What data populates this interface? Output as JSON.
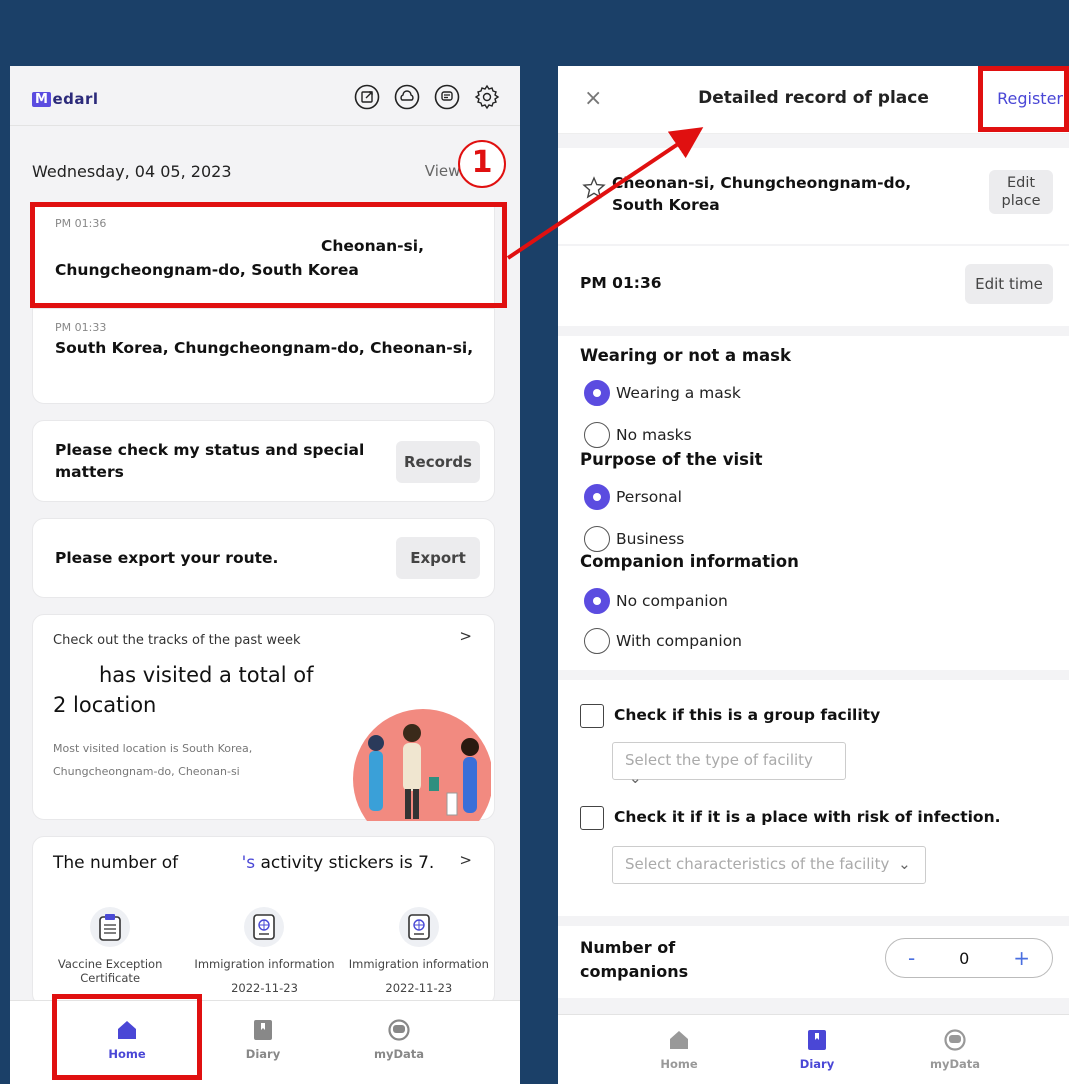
{
  "left": {
    "logo": "Medarl",
    "date": "Wednesday, 04 05, 2023",
    "view_all": "View all >",
    "entries": [
      {
        "time": "PM 01:36",
        "line1": "Cheonan-si,",
        "line2": "Chungcheongnam-do, South Korea"
      },
      {
        "time": "PM 01:33",
        "line1": "South Korea, Chungcheongnam-do, Cheonan-si,"
      }
    ],
    "status_card": {
      "text": "Please check my status and special matters",
      "button": "Records"
    },
    "export_card": {
      "text": "Please export your route.",
      "button": "Export"
    },
    "tracks_card": {
      "header": "Check out the tracks of the past week",
      "chevron": ">",
      "line1": "has visited a total of",
      "line2": "2 location",
      "desc": "Most visited location is South Korea, Chungcheongnam-do, Cheonan-si"
    },
    "stickers_card": {
      "title_prefix": "The number of",
      "title_possessive": "'s",
      "title_suffix": "activity stickers is 7.",
      "chevron": ">",
      "items": [
        {
          "label": "Vaccine Exception Certificate",
          "date": "",
          "icon": "clipboard-icon"
        },
        {
          "label": "Immigration information",
          "date": "2022-11-23",
          "icon": "passport-icon"
        },
        {
          "label": "Immigration information",
          "date": "2022-11-23",
          "icon": "passport-icon"
        }
      ]
    },
    "nav": [
      {
        "label": "Home",
        "icon": "home-icon",
        "active": true
      },
      {
        "label": "Diary",
        "icon": "diary-icon",
        "active": false
      },
      {
        "label": "myData",
        "icon": "mydata-icon",
        "active": false
      }
    ]
  },
  "right": {
    "close": "×",
    "title": "Detailed record of place",
    "register": "Register",
    "place": "Cheonan-si, Chungcheongnam-do, South Korea",
    "edit_place": "Edit place",
    "time": "PM 01:36",
    "edit_time": "Edit time",
    "mask": {
      "heading": "Wearing or not a mask",
      "options": [
        "Wearing a mask",
        "No masks"
      ],
      "selected": 0
    },
    "purpose": {
      "heading": "Purpose of the visit",
      "options": [
        "Personal",
        "Business"
      ],
      "selected": 0
    },
    "companion": {
      "heading": "Companion information",
      "options": [
        "No companion",
        "With companion"
      ],
      "selected": 0
    },
    "group_facility": {
      "label": "Check if this is a group facility",
      "select_placeholder": "Select the type of facility"
    },
    "risk": {
      "label": "Check it if it is a place with risk of infection.",
      "select_placeholder": "Select characteristics of the facility"
    },
    "companions_count": {
      "label": "Number of companions",
      "minus": "-",
      "value": "0",
      "plus": "+"
    },
    "nav": [
      {
        "label": "Home",
        "icon": "home-icon",
        "active": false
      },
      {
        "label": "Diary",
        "icon": "diary-icon",
        "active": true
      },
      {
        "label": "myData",
        "icon": "mydata-icon",
        "active": false
      }
    ]
  },
  "annotation": {
    "step_number": "1"
  },
  "colors": {
    "accent": "#5b4ce0",
    "highlight": "#e01010",
    "background": "#1b4068"
  }
}
